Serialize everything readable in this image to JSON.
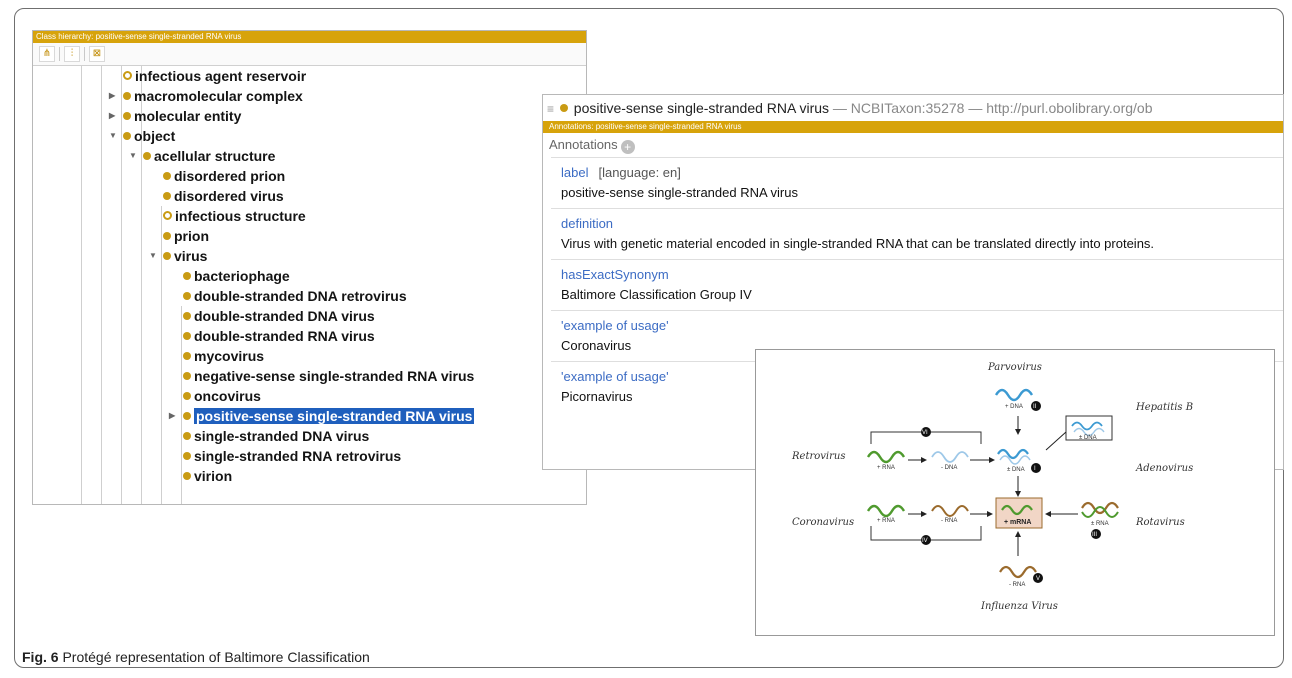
{
  "hierarchy": {
    "title": "Class hierarchy: positive-sense single-stranded RNA virus",
    "toolbar": [
      "add-subclass-icon",
      "add-sibling-icon",
      "delete-icon"
    ],
    "nodes": [
      {
        "label": "infectious agent reservoir",
        "hollow": true
      },
      {
        "label": "macromolecular complex",
        "toggle": "collapsed"
      },
      {
        "label": "molecular entity",
        "toggle": "collapsed"
      },
      {
        "label": "object",
        "toggle": "expanded"
      },
      {
        "label": "acellular structure",
        "toggle": "expanded"
      },
      {
        "label": "disordered prion"
      },
      {
        "label": "disordered virus"
      },
      {
        "label": "infectious structure",
        "hollow": true
      },
      {
        "label": "prion"
      },
      {
        "label": "virus",
        "toggle": "expanded"
      },
      {
        "label": "bacteriophage"
      },
      {
        "label": "double-stranded DNA retrovirus"
      },
      {
        "label": "double-stranded DNA virus"
      },
      {
        "label": "double-stranded RNA virus"
      },
      {
        "label": "mycovirus"
      },
      {
        "label": "negative-sense single-stranded RNA virus"
      },
      {
        "label": "oncovirus"
      },
      {
        "label": "positive-sense single-stranded RNA virus",
        "toggle": "collapsed",
        "selected": true
      },
      {
        "label": "single-stranded DNA virus"
      },
      {
        "label": "single-stranded RNA retrovirus"
      },
      {
        "label": "virion"
      }
    ]
  },
  "annotations": {
    "header_title": "positive-sense single-stranded RNA virus",
    "header_id": "— NCBITaxon:35278 — http://purl.obolibrary.org/ob",
    "bar_title": "Annotations: positive-sense single-stranded RNA virus",
    "section_label": "Annotations",
    "entries": [
      {
        "prop": "label",
        "lang": "[language: en]",
        "value": "positive-sense single-stranded RNA virus"
      },
      {
        "prop": "definition",
        "lang": "",
        "value": "Virus with genetic material encoded in single-stranded RNA that can be translated directly into proteins."
      },
      {
        "prop": "hasExactSynonym",
        "lang": "",
        "value": "Baltimore Classification Group IV"
      },
      {
        "prop": "'example of usage'",
        "lang": "",
        "value": "Coronavirus"
      },
      {
        "prop": "'example of usage'",
        "lang": "",
        "value": "Picornavirus"
      }
    ]
  },
  "diagram": {
    "viruses": {
      "parvovirus": "Parvovirus",
      "hepatitis_b": "Hepatitis B",
      "retrovirus": "Retrovirus",
      "adenovirus": "Adenovirus",
      "coronavirus": "Coronavirus",
      "rotavirus": "Rotavirus",
      "influenza": "Influenza Virus"
    },
    "labels": {
      "plus_dna": "+ DNA",
      "plus_rna": "+ RNA",
      "minus_dna": "- DNA",
      "pm_dna": "± DNA",
      "minus_rna": "- RNA",
      "mrna": "+ mRNA",
      "pm_rna": "± RNA",
      "minus_rna_bottom": "- RNA"
    },
    "groups": [
      "II",
      "VI",
      "I",
      "IV",
      "VII",
      "III",
      "V"
    ],
    "colors": {
      "green": "#4f9a2e",
      "blue": "#3c9ad2",
      "brown": "#9b6b2d",
      "mrna_box": "#f1d6c6"
    }
  },
  "caption": {
    "bold": "Fig. 6",
    "text": " Protégé representation of Baltimore Classification"
  }
}
